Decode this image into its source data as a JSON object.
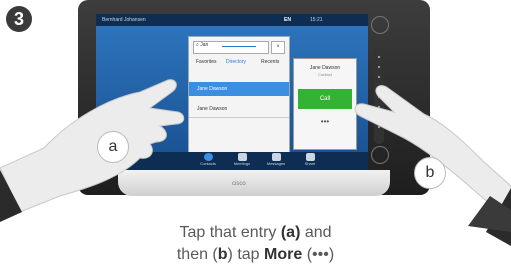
{
  "step": {
    "number": "3"
  },
  "device": {
    "brand": "cisco",
    "status_bar": {
      "user": "Bernhard Johansen",
      "language": "EN",
      "time": "15:21"
    },
    "search": {
      "query": "Jan",
      "close": "×"
    },
    "tabs": [
      {
        "label": "Favorites"
      },
      {
        "label": "Directory"
      },
      {
        "label": "Recents"
      }
    ],
    "selected_entry": "Jane Dawson",
    "list_entry": "Jane Dawson",
    "contact_card": {
      "name": "Jane Dawson",
      "subtitle": "Contact",
      "call_label": "Call",
      "more": "•••"
    },
    "bottom_bar": [
      {
        "label": "Contacts"
      },
      {
        "label": "Meetings"
      },
      {
        "label": "Messages"
      },
      {
        "label": "Share"
      }
    ]
  },
  "labels": {
    "a": "a",
    "b": "b"
  },
  "caption": {
    "line1_pre": "Tap that entry ",
    "line1_a": "(a)",
    "line1_post": " and",
    "line2_pre": "then (",
    "line2_b": "b",
    "line2_mid": ") tap ",
    "line2_more": "More",
    "line2_post": " (•••)"
  },
  "colors": {
    "call_green": "#34b233",
    "screen_blue": "#2f77c0",
    "accent": "#2a7bd0"
  }
}
